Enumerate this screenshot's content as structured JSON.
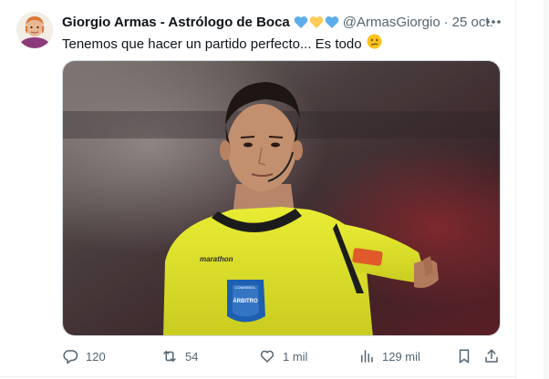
{
  "tweet": {
    "author_name": "Giorgio Armas - Astrólogo de Boca",
    "badges": [
      "blue-heart-icon",
      "yellow-heart-icon",
      "blue-heart-icon"
    ],
    "handle": "@ArmasGiorgio",
    "separator": "·",
    "date": "25 oct.",
    "text": "Tenemos que hacer un partido perfecto... Es todo",
    "emoji": "confused-face-icon",
    "media": {
      "jersey_brand": "marathon",
      "badge_top": "CONMEBOL",
      "badge_text": "ÁRBITRO"
    }
  },
  "actions": {
    "replies": "120",
    "retweets": "54",
    "likes": "1 mil",
    "views": "129 mil"
  },
  "colors": {
    "text": "#0f1419",
    "secondary": "#536471",
    "border": "#cfd9de",
    "jersey": "#e3e82c",
    "badge_blue": "#1d5fb0"
  }
}
